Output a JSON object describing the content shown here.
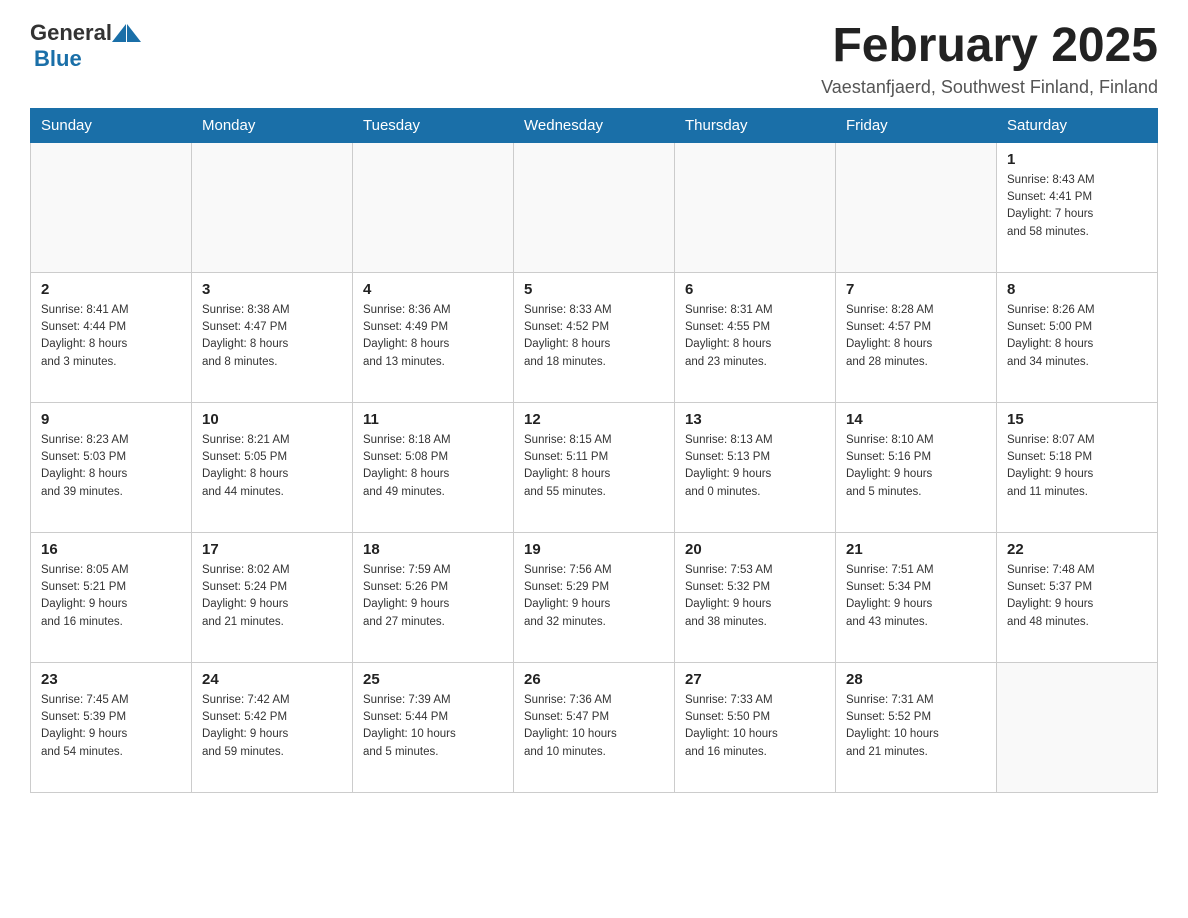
{
  "header": {
    "logo_general": "General",
    "logo_blue": "Blue",
    "month_title": "February 2025",
    "subtitle": "Vaestanfjaerd, Southwest Finland, Finland"
  },
  "calendar": {
    "days_of_week": [
      "Sunday",
      "Monday",
      "Tuesday",
      "Wednesday",
      "Thursday",
      "Friday",
      "Saturday"
    ],
    "weeks": [
      [
        {
          "day": "",
          "info": ""
        },
        {
          "day": "",
          "info": ""
        },
        {
          "day": "",
          "info": ""
        },
        {
          "day": "",
          "info": ""
        },
        {
          "day": "",
          "info": ""
        },
        {
          "day": "",
          "info": ""
        },
        {
          "day": "1",
          "info": "Sunrise: 8:43 AM\nSunset: 4:41 PM\nDaylight: 7 hours\nand 58 minutes."
        }
      ],
      [
        {
          "day": "2",
          "info": "Sunrise: 8:41 AM\nSunset: 4:44 PM\nDaylight: 8 hours\nand 3 minutes."
        },
        {
          "day": "3",
          "info": "Sunrise: 8:38 AM\nSunset: 4:47 PM\nDaylight: 8 hours\nand 8 minutes."
        },
        {
          "day": "4",
          "info": "Sunrise: 8:36 AM\nSunset: 4:49 PM\nDaylight: 8 hours\nand 13 minutes."
        },
        {
          "day": "5",
          "info": "Sunrise: 8:33 AM\nSunset: 4:52 PM\nDaylight: 8 hours\nand 18 minutes."
        },
        {
          "day": "6",
          "info": "Sunrise: 8:31 AM\nSunset: 4:55 PM\nDaylight: 8 hours\nand 23 minutes."
        },
        {
          "day": "7",
          "info": "Sunrise: 8:28 AM\nSunset: 4:57 PM\nDaylight: 8 hours\nand 28 minutes."
        },
        {
          "day": "8",
          "info": "Sunrise: 8:26 AM\nSunset: 5:00 PM\nDaylight: 8 hours\nand 34 minutes."
        }
      ],
      [
        {
          "day": "9",
          "info": "Sunrise: 8:23 AM\nSunset: 5:03 PM\nDaylight: 8 hours\nand 39 minutes."
        },
        {
          "day": "10",
          "info": "Sunrise: 8:21 AM\nSunset: 5:05 PM\nDaylight: 8 hours\nand 44 minutes."
        },
        {
          "day": "11",
          "info": "Sunrise: 8:18 AM\nSunset: 5:08 PM\nDaylight: 8 hours\nand 49 minutes."
        },
        {
          "day": "12",
          "info": "Sunrise: 8:15 AM\nSunset: 5:11 PM\nDaylight: 8 hours\nand 55 minutes."
        },
        {
          "day": "13",
          "info": "Sunrise: 8:13 AM\nSunset: 5:13 PM\nDaylight: 9 hours\nand 0 minutes."
        },
        {
          "day": "14",
          "info": "Sunrise: 8:10 AM\nSunset: 5:16 PM\nDaylight: 9 hours\nand 5 minutes."
        },
        {
          "day": "15",
          "info": "Sunrise: 8:07 AM\nSunset: 5:18 PM\nDaylight: 9 hours\nand 11 minutes."
        }
      ],
      [
        {
          "day": "16",
          "info": "Sunrise: 8:05 AM\nSunset: 5:21 PM\nDaylight: 9 hours\nand 16 minutes."
        },
        {
          "day": "17",
          "info": "Sunrise: 8:02 AM\nSunset: 5:24 PM\nDaylight: 9 hours\nand 21 minutes."
        },
        {
          "day": "18",
          "info": "Sunrise: 7:59 AM\nSunset: 5:26 PM\nDaylight: 9 hours\nand 27 minutes."
        },
        {
          "day": "19",
          "info": "Sunrise: 7:56 AM\nSunset: 5:29 PM\nDaylight: 9 hours\nand 32 minutes."
        },
        {
          "day": "20",
          "info": "Sunrise: 7:53 AM\nSunset: 5:32 PM\nDaylight: 9 hours\nand 38 minutes."
        },
        {
          "day": "21",
          "info": "Sunrise: 7:51 AM\nSunset: 5:34 PM\nDaylight: 9 hours\nand 43 minutes."
        },
        {
          "day": "22",
          "info": "Sunrise: 7:48 AM\nSunset: 5:37 PM\nDaylight: 9 hours\nand 48 minutes."
        }
      ],
      [
        {
          "day": "23",
          "info": "Sunrise: 7:45 AM\nSunset: 5:39 PM\nDaylight: 9 hours\nand 54 minutes."
        },
        {
          "day": "24",
          "info": "Sunrise: 7:42 AM\nSunset: 5:42 PM\nDaylight: 9 hours\nand 59 minutes."
        },
        {
          "day": "25",
          "info": "Sunrise: 7:39 AM\nSunset: 5:44 PM\nDaylight: 10 hours\nand 5 minutes."
        },
        {
          "day": "26",
          "info": "Sunrise: 7:36 AM\nSunset: 5:47 PM\nDaylight: 10 hours\nand 10 minutes."
        },
        {
          "day": "27",
          "info": "Sunrise: 7:33 AM\nSunset: 5:50 PM\nDaylight: 10 hours\nand 16 minutes."
        },
        {
          "day": "28",
          "info": "Sunrise: 7:31 AM\nSunset: 5:52 PM\nDaylight: 10 hours\nand 21 minutes."
        },
        {
          "day": "",
          "info": ""
        }
      ]
    ]
  }
}
